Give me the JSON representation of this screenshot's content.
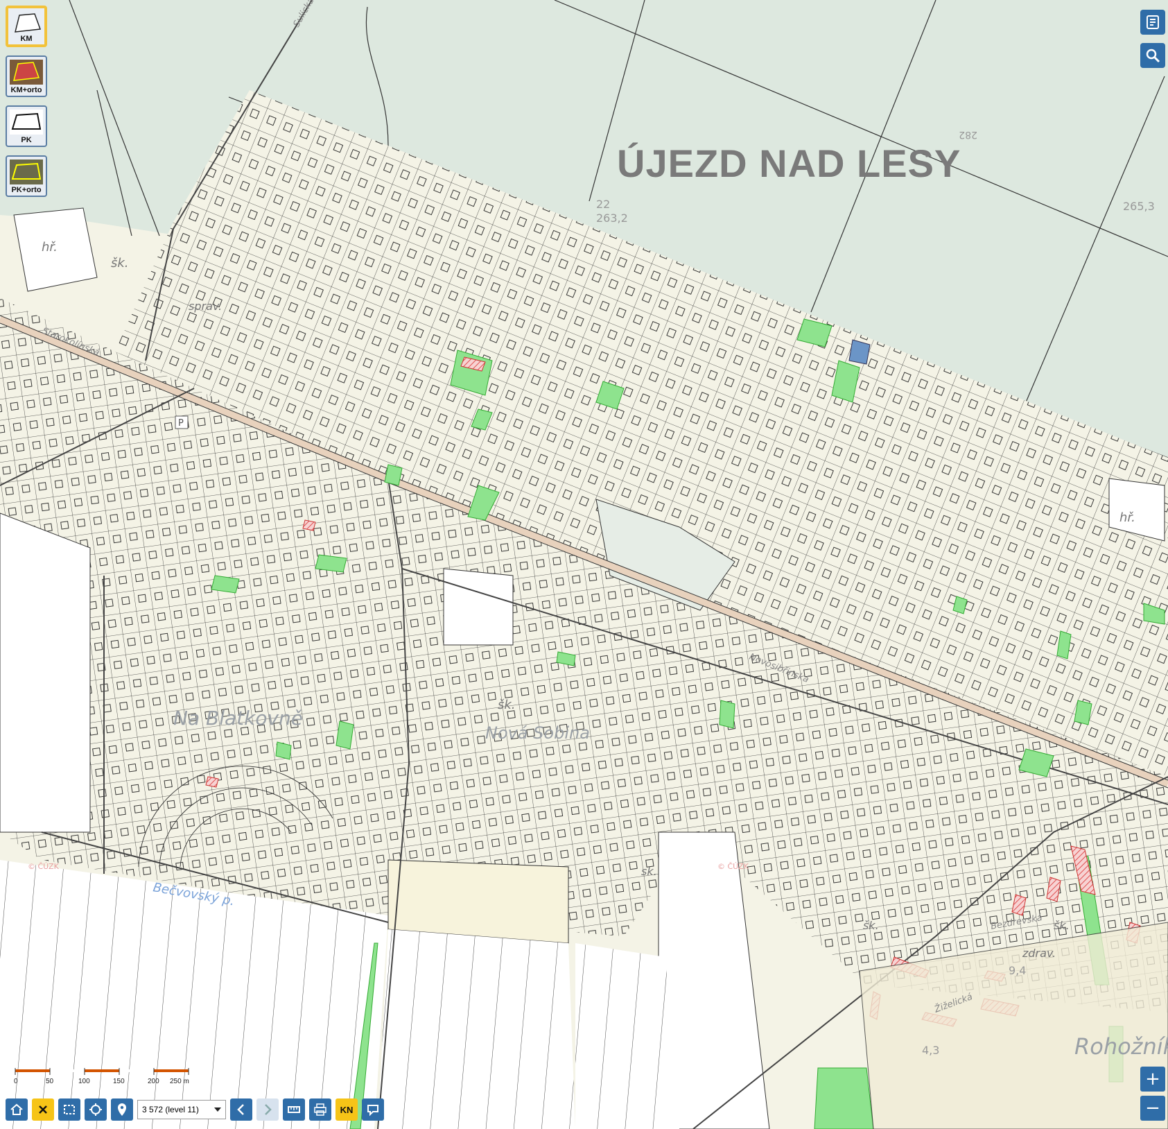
{
  "map": {
    "region_label": "ÚJEZD NAD LESY",
    "place_labels": [
      "Na Blatkovně",
      "Rohožník",
      "Nová Sobina"
    ],
    "building_labels": [
      "hř.",
      "šk.",
      "sprav.",
      "šk.",
      "hř.",
      "šk.",
      "zdrav.",
      "šk.",
      "sk."
    ],
    "street_labels": [
      "Starokolínská",
      "Novosibřinská",
      "Sulická",
      "Žiželická",
      "Bezdrevská"
    ],
    "stream_labels": [
      "Bečvovský p."
    ],
    "elevation_labels": [
      "263,2",
      "265,3",
      "22",
      "282",
      "4,3",
      "9,4"
    ],
    "copyright_labels": [
      "© ČÚZK",
      "© ČÚZK"
    ],
    "parking_label": "P",
    "colors": {
      "forest": "#dde8df",
      "parcel": "#f4f3e6",
      "road": "#e8d2bd",
      "green_parcel": "#8ee38e",
      "hatch": "#e05050",
      "blue_parcel": "#6b95c7"
    }
  },
  "layers": [
    {
      "label": "KM",
      "active": true
    },
    {
      "label": "KM+orto",
      "active": false
    },
    {
      "label": "PK",
      "active": false
    },
    {
      "label": "PK+orto",
      "active": false
    }
  ],
  "right_buttons": [
    {
      "name": "legend-icon"
    },
    {
      "name": "search-icon"
    }
  ],
  "scalebar": {
    "ticks": [
      "0",
      "50",
      "100",
      "150",
      "200",
      "250 m"
    ]
  },
  "toolbar": {
    "scale_value": "3 572 (level 11)",
    "kn_label": "KN"
  },
  "zoom": {
    "in": "+",
    "out": "−"
  }
}
